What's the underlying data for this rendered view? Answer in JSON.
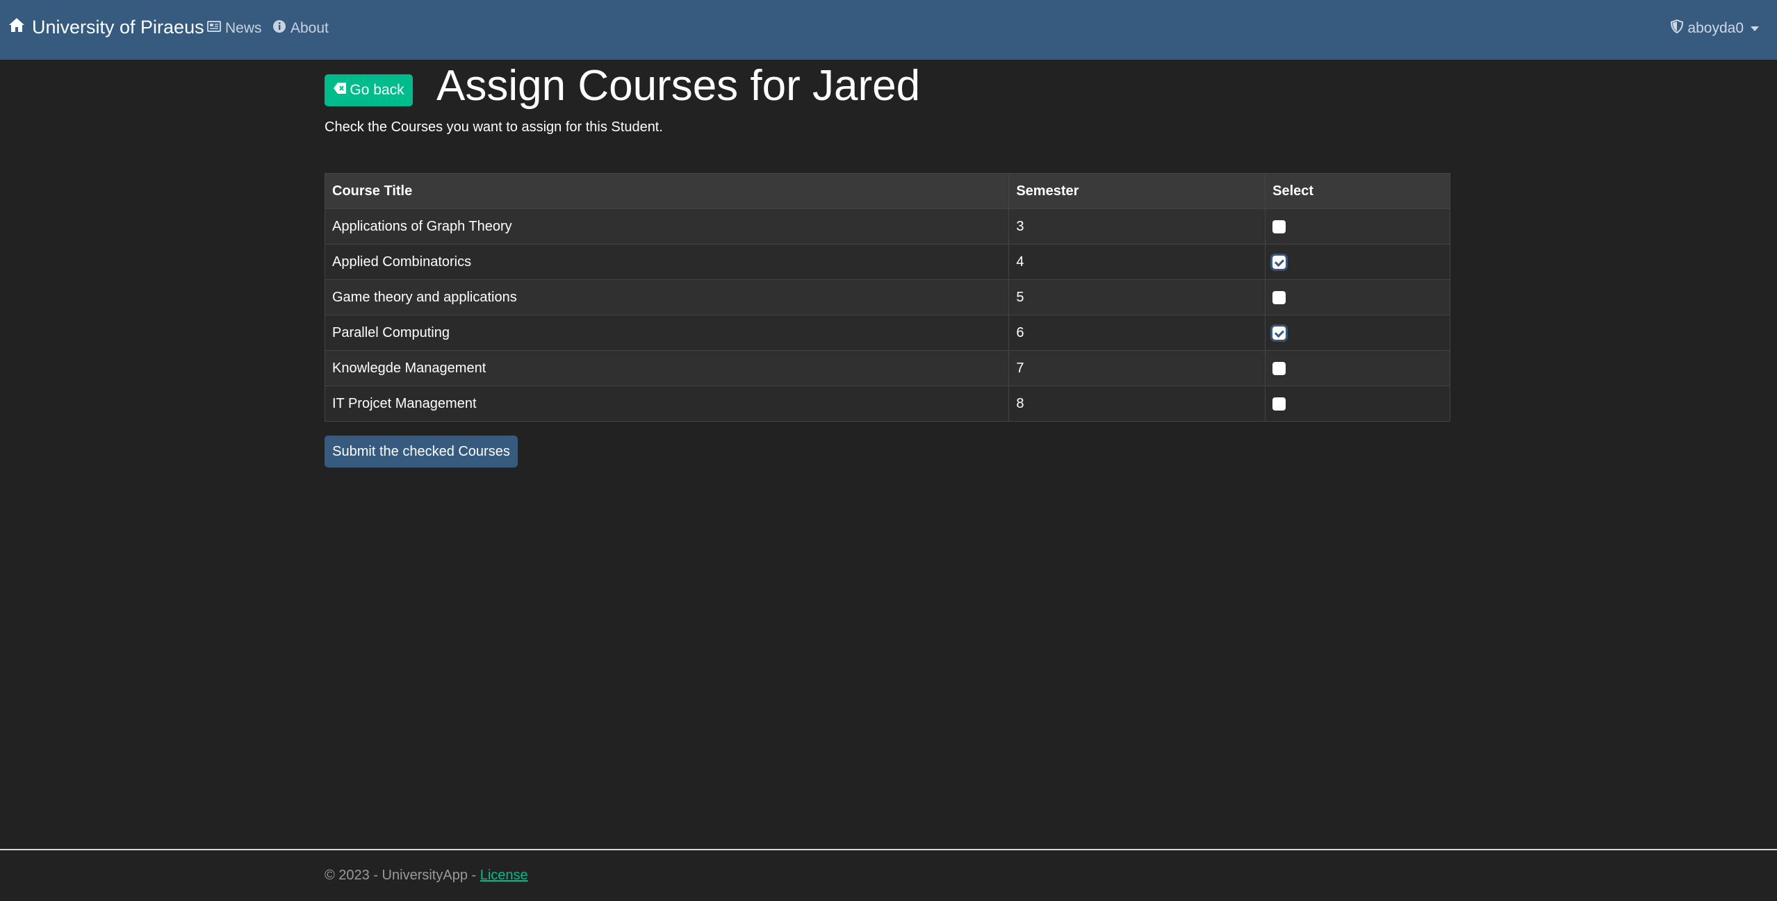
{
  "navbar": {
    "brand": "University of Piraeus",
    "news_label": "News",
    "about_label": "About",
    "user_label": "aboyda0",
    "color": "#375a7f"
  },
  "page": {
    "go_back_label": "Go back",
    "title": "Assign Courses for Jared",
    "instructions": "Check the Courses you want to assign for this Student."
  },
  "table": {
    "headers": {
      "title": "Course Title",
      "semester": "Semester",
      "select": "Select"
    },
    "rows": [
      {
        "title": "Applications of Graph Theory",
        "semester": "3",
        "checked": false
      },
      {
        "title": "Applied Combinatorics",
        "semester": "4",
        "checked": true
      },
      {
        "title": "Game theory and applications",
        "semester": "5",
        "checked": false
      },
      {
        "title": "Parallel Computing",
        "semester": "6",
        "checked": true
      },
      {
        "title": "Knowlegde Management",
        "semester": "7",
        "checked": false
      },
      {
        "title": "IT Projcet Management",
        "semester": "8",
        "checked": false
      }
    ]
  },
  "submit_label": "Submit the checked Courses",
  "footer": {
    "text": "© 2023 - UniversityApp - ",
    "license_label": "License",
    "accent": "#00bc8c"
  }
}
